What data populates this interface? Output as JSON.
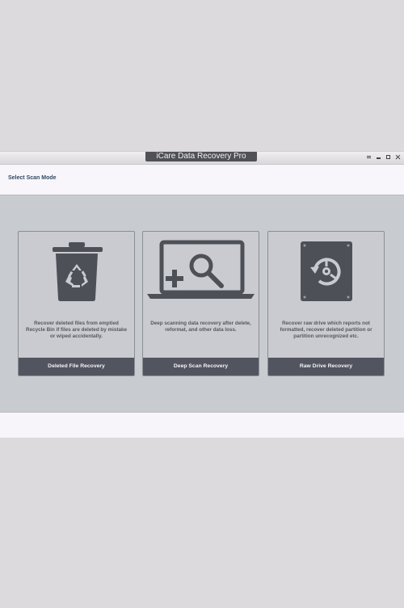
{
  "window": {
    "title": "iCare Data Recovery Pro",
    "controls": [
      "menu-icon",
      "minimize-icon",
      "restore-icon",
      "close-icon"
    ]
  },
  "header": {
    "label": "Select Scan Mode"
  },
  "modes": [
    {
      "icon": "recycle-bin-icon",
      "description": "Recover deleted files from emptied Recycle Bin if files are deleted by mistake or wiped accidentally.",
      "button": "Deleted File Recovery"
    },
    {
      "icon": "laptop-search-icon",
      "description": "Deep scanning data recovery after delete, reformat, and other data loss.",
      "button": "Deep Scan Recovery"
    },
    {
      "icon": "hard-drive-recover-icon",
      "description": "Recover raw drive which reports not formatted, recover deleted partition or partition unrecognized etc.",
      "button": "Raw Drive Recovery"
    }
  ],
  "colors": {
    "button_bg": "#525560",
    "icon_color": "#4d5057",
    "content_bg": "#c8cbd0",
    "header_text": "#2f4a63"
  }
}
